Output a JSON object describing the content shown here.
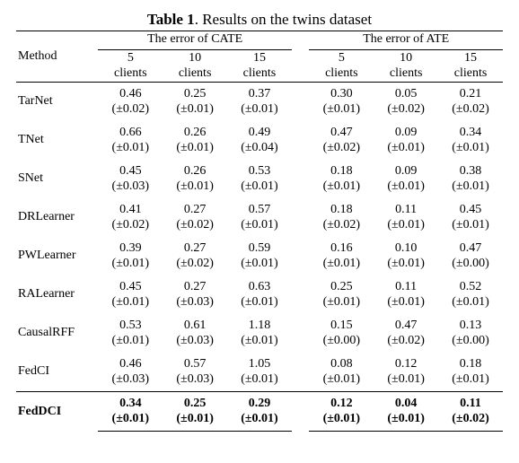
{
  "caption": {
    "label": "Table 1",
    "title": "Results on the twins dataset"
  },
  "header": {
    "method": "Method",
    "group_cate": "The error of CATE",
    "group_ate": "The error of ATE",
    "cols": [
      "5 clients",
      "10 clients",
      "15 clients",
      "5 clients",
      "10 clients",
      "15 clients"
    ],
    "col_top": [
      "5",
      "10",
      "15",
      "5",
      "10",
      "15"
    ],
    "col_bot": "clients"
  },
  "rows": [
    {
      "method": "TarNet",
      "vals": [
        "0.46",
        "0.25",
        "0.37",
        "0.30",
        "0.05",
        "0.21"
      ],
      "errs": [
        "(±0.02)",
        "(±0.01)",
        "(±0.01)",
        "(±0.01)",
        "(±0.02)",
        "(±0.02)"
      ]
    },
    {
      "method": "TNet",
      "vals": [
        "0.66",
        "0.26",
        "0.49",
        "0.47",
        "0.09",
        "0.34"
      ],
      "errs": [
        "(±0.01)",
        "(±0.01)",
        "(±0.04)",
        "(±0.02)",
        "(±0.01)",
        "(±0.01)"
      ]
    },
    {
      "method": "SNet",
      "vals": [
        "0.45",
        "0.26",
        "0.53",
        "0.18",
        "0.09",
        "0.38"
      ],
      "errs": [
        "(±0.03)",
        "(±0.01)",
        "(±0.01)",
        "(±0.01)",
        "(±0.01)",
        "(±0.01)"
      ]
    },
    {
      "method": "DRLearner",
      "vals": [
        "0.41",
        "0.27",
        "0.57",
        "0.18",
        "0.11",
        "0.45"
      ],
      "errs": [
        "(±0.02)",
        "(±0.02)",
        "(±0.01)",
        "(±0.02)",
        "(±0.01)",
        "(±0.01)"
      ]
    },
    {
      "method": "PWLearner",
      "vals": [
        "0.39",
        "0.27",
        "0.59",
        "0.16",
        "0.10",
        "0.47"
      ],
      "errs": [
        "(±0.01)",
        "(±0.02)",
        "(±0.01)",
        "(±0.01)",
        "(±0.01)",
        "(±0.00)"
      ]
    },
    {
      "method": "RALearner",
      "vals": [
        "0.45",
        "0.27",
        "0.63",
        "0.25",
        "0.11",
        "0.52"
      ],
      "errs": [
        "(±0.01)",
        "(±0.03)",
        "(±0.01)",
        "(±0.01)",
        "(±0.01)",
        "(±0.01)"
      ]
    },
    {
      "method": "CausalRFF",
      "vals": [
        "0.53",
        "0.61",
        "1.18",
        "0.15",
        "0.47",
        "0.13"
      ],
      "errs": [
        "(±0.01)",
        "(±0.03)",
        "(±0.01)",
        "(±0.00)",
        "(±0.02)",
        "(±0.00)"
      ]
    },
    {
      "method": "FedCI",
      "vals": [
        "0.46",
        "0.57",
        "1.05",
        "0.08",
        "0.12",
        "0.18"
      ],
      "errs": [
        "(±0.03)",
        "(±0.03)",
        "(±0.01)",
        "(±0.01)",
        "(±0.01)",
        "(±0.01)"
      ]
    },
    {
      "method": "FedDCI",
      "vals": [
        "0.34",
        "0.25",
        "0.29",
        "0.12",
        "0.04",
        "0.11"
      ],
      "errs": [
        "(±0.01)",
        "(±0.01)",
        "(±0.01)",
        "(±0.01)",
        "(±0.01)",
        "(±0.02)"
      ]
    }
  ],
  "bold_rows": [
    8
  ],
  "chart_data": {
    "type": "table",
    "title": "Results on the twins dataset",
    "column_groups": [
      "The error of CATE",
      "The error of ATE"
    ],
    "columns": [
      "Method",
      "CATE 5 clients",
      "CATE 10 clients",
      "CATE 15 clients",
      "ATE 5 clients",
      "ATE 10 clients",
      "ATE 15 clients"
    ],
    "values": [
      [
        "TarNet",
        0.46,
        0.25,
        0.37,
        0.3,
        0.05,
        0.21
      ],
      [
        "TNet",
        0.66,
        0.26,
        0.49,
        0.47,
        0.09,
        0.34
      ],
      [
        "SNet",
        0.45,
        0.26,
        0.53,
        0.18,
        0.09,
        0.38
      ],
      [
        "DRLearner",
        0.41,
        0.27,
        0.57,
        0.18,
        0.11,
        0.45
      ],
      [
        "PWLearner",
        0.39,
        0.27,
        0.59,
        0.16,
        0.1,
        0.47
      ],
      [
        "RALearner",
        0.45,
        0.27,
        0.63,
        0.25,
        0.11,
        0.52
      ],
      [
        "CausalRFF",
        0.53,
        0.61,
        1.18,
        0.15,
        0.47,
        0.13
      ],
      [
        "FedCI",
        0.46,
        0.57,
        1.05,
        0.08,
        0.12,
        0.18
      ],
      [
        "FedDCI",
        0.34,
        0.25,
        0.29,
        0.12,
        0.04,
        0.11
      ]
    ],
    "std": [
      [
        0.02,
        0.01,
        0.01,
        0.01,
        0.02,
        0.02
      ],
      [
        0.01,
        0.01,
        0.04,
        0.02,
        0.01,
        0.01
      ],
      [
        0.03,
        0.01,
        0.01,
        0.01,
        0.01,
        0.01
      ],
      [
        0.02,
        0.02,
        0.01,
        0.02,
        0.01,
        0.01
      ],
      [
        0.01,
        0.02,
        0.01,
        0.01,
        0.01,
        0.0
      ],
      [
        0.01,
        0.03,
        0.01,
        0.01,
        0.01,
        0.01
      ],
      [
        0.01,
        0.03,
        0.01,
        0.0,
        0.02,
        0.0
      ],
      [
        0.03,
        0.03,
        0.01,
        0.01,
        0.01,
        0.01
      ],
      [
        0.01,
        0.01,
        0.01,
        0.01,
        0.01,
        0.02
      ]
    ],
    "highlight_row": "FedDCI"
  }
}
